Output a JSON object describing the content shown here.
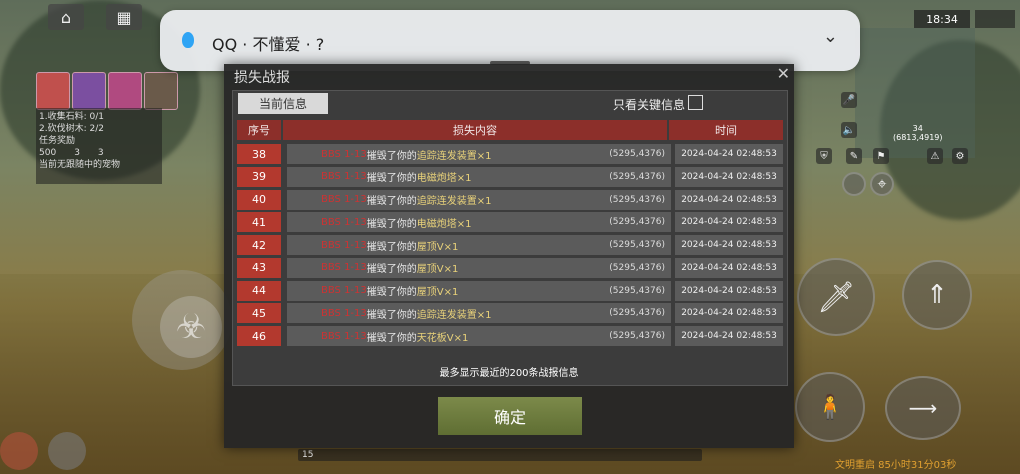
{
  "notification": {
    "app": "QQ",
    "sep1": "·",
    "sender": "不懂爱",
    "sep2": "·",
    "message": "?"
  },
  "status": {
    "time": "18:34"
  },
  "hud_left": {
    "task1": "1.收集石料: 0/1",
    "task2": "2.砍伐树木: 2/2",
    "task_label": "任务奖励",
    "reward_count": "500",
    "reward2": "3",
    "reward3": "3",
    "pet_hint": "当前无跟随中的宠物"
  },
  "hud_right": {
    "map_level": "34",
    "map_coords": "(6813,4919)",
    "footer": "文明重启 85小时31分03秒"
  },
  "bottom_bar": {
    "value": "15"
  },
  "dialog": {
    "title": "损失战报",
    "tab_current": "当前信息",
    "key_only_label": "只看关键信息",
    "key_only_checked": false,
    "columns": {
      "seq": "序号",
      "content": "损失内容",
      "time": "时间"
    },
    "rows": [
      {
        "seq": "38",
        "player": "BBS 1-13",
        "verb": "摧毁了你的",
        "item": "追踪连发装置×1",
        "coord": "(5295,4376)",
        "time": "2024-04-24 02:48:53"
      },
      {
        "seq": "39",
        "player": "BBS 1-13",
        "verb": "摧毁了你的",
        "item": "电磁炮塔×1",
        "coord": "(5295,4376)",
        "time": "2024-04-24 02:48:53"
      },
      {
        "seq": "40",
        "player": "BBS 1-13",
        "verb": "摧毁了你的",
        "item": "追踪连发装置×1",
        "coord": "(5295,4376)",
        "time": "2024-04-24 02:48:53"
      },
      {
        "seq": "41",
        "player": "BBS 1-13",
        "verb": "摧毁了你的",
        "item": "电磁炮塔×1",
        "coord": "(5295,4376)",
        "time": "2024-04-24 02:48:53"
      },
      {
        "seq": "42",
        "player": "BBS 1-13",
        "verb": "摧毁了你的",
        "item": "屋顶V×1",
        "coord": "(5295,4376)",
        "time": "2024-04-24 02:48:53"
      },
      {
        "seq": "43",
        "player": "BBS 1-13",
        "verb": "摧毁了你的",
        "item": "屋顶V×1",
        "coord": "(5295,4376)",
        "time": "2024-04-24 02:48:53"
      },
      {
        "seq": "44",
        "player": "BBS 1-13",
        "verb": "摧毁了你的",
        "item": "屋顶V×1",
        "coord": "(5295,4376)",
        "time": "2024-04-24 02:48:53"
      },
      {
        "seq": "45",
        "player": "BBS 1-13",
        "verb": "摧毁了你的",
        "item": "追踪连发装置×1",
        "coord": "(5295,4376)",
        "time": "2024-04-24 02:48:53"
      },
      {
        "seq": "46",
        "player": "BBS 1-13",
        "verb": "摧毁了你的",
        "item": "天花板V×1",
        "coord": "(5295,4376)",
        "time": "2024-04-24 02:48:53"
      }
    ],
    "note": "最多显示最近的200条战报信息",
    "confirm": "确定"
  }
}
